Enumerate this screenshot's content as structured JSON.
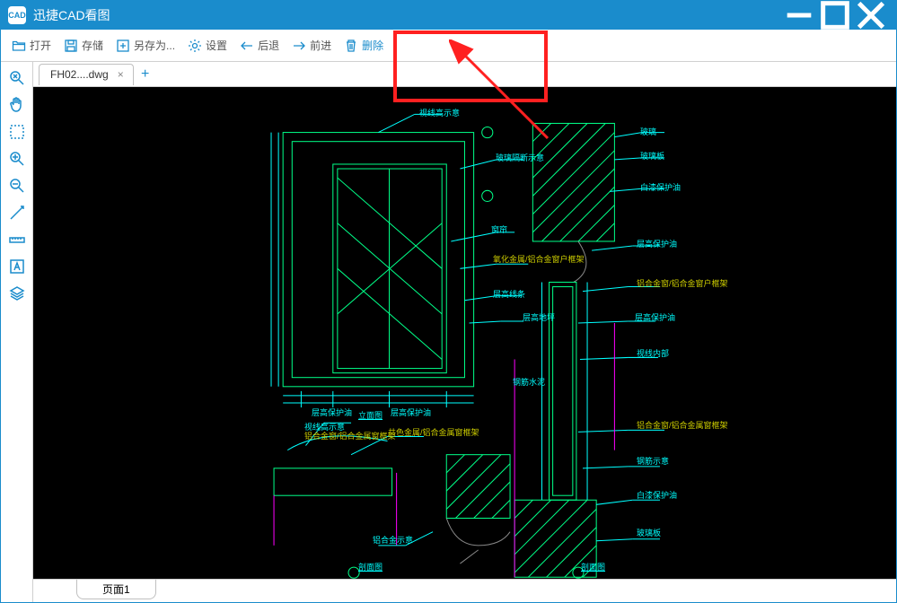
{
  "app": {
    "title": "迅捷CAD看图",
    "logo": "CAD"
  },
  "toolbar": {
    "open": "打开",
    "save": "存储",
    "saveas": "另存为...",
    "settings": "设置",
    "undo": "后退",
    "redo": "前进",
    "delete": "删除"
  },
  "tabs": {
    "items": [
      {
        "label": "FH02....dwg"
      }
    ]
  },
  "sidebar": {
    "tools": [
      "zoom-extents",
      "pan",
      "select-window",
      "zoom-in",
      "zoom-out",
      "draw-line",
      "measure",
      "text",
      "layer"
    ]
  },
  "bottom": {
    "page_label": "页面1"
  },
  "annotations": {
    "a1": "视线高示意",
    "a2": "玻璃隔断示意",
    "a3": "窗帘",
    "a4": "氧化金属/铝合金窗户框架",
    "a5": "层高线条",
    "a6": "层高地坪",
    "a7": "白漆保护油",
    "a8": "层高保护油",
    "a9": "层高保护油",
    "a10": "立面图",
    "a11": "视线高示意",
    "a12": "铝合金窗/铝合金属窗框架",
    "a13": "共色金属/铝合金属窗框架",
    "a14": "铝合金示意",
    "a15": "剖面图",
    "a16": "玻璃",
    "a17": "玻璃板",
    "a18": "白漆保护油",
    "a19": "层高保护油",
    "a20": "玻璃板",
    "a21": "钢筋水泥",
    "a22": "铝合金窗/铝合金窗户框架",
    "a23": "层高保护油",
    "a24": "视线内部",
    "a25": "钢筋示意",
    "a26": "铝合金窗/铝合金属窗框架",
    "a27": "白漆保护油",
    "a28": "剖面图"
  }
}
